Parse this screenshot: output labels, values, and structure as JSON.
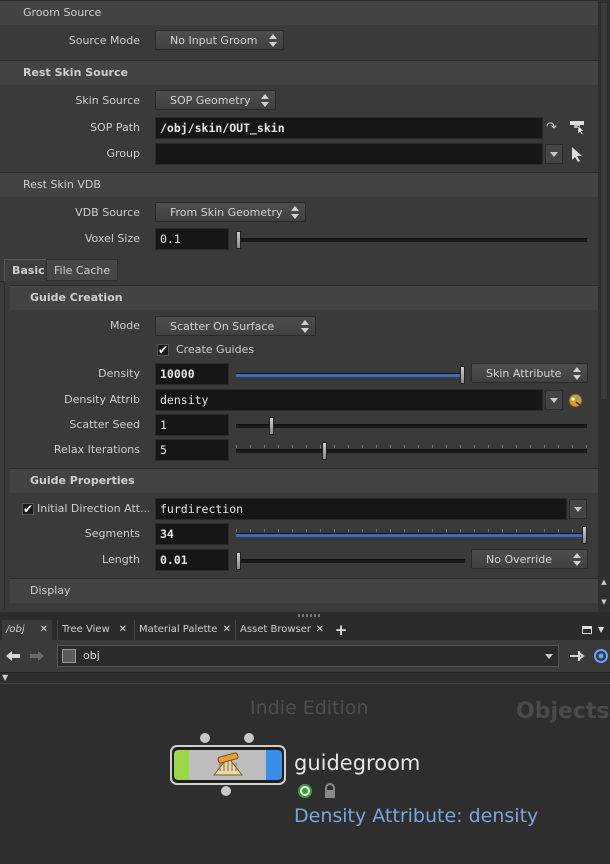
{
  "params": {
    "groom_source": {
      "header": "Groom Source",
      "source_mode_label": "Source Mode",
      "source_mode_value": "No Input Groom"
    },
    "rest_skin_source": {
      "header": "Rest Skin Source",
      "skin_source_label": "Skin Source",
      "skin_source_value": "SOP Geometry",
      "sop_path_label": "SOP Path",
      "sop_path_value": "/obj/skin/OUT_skin",
      "group_label": "Group",
      "group_value": ""
    },
    "rest_skin_vdb": {
      "header": "Rest Skin VDB",
      "vdb_source_label": "VDB Source",
      "vdb_source_value": "From Skin Geometry",
      "voxel_size_label": "Voxel Size",
      "voxel_size_value": "0.1",
      "voxel_size_fraction": 0.0
    },
    "tabs": [
      "Basic",
      "File Cache"
    ],
    "active_tab": "Basic",
    "guide_creation": {
      "header": "Guide Creation",
      "mode_label": "Mode",
      "mode_value": "Scatter On Surface",
      "create_guides_label": "Create Guides",
      "create_guides_checked": true,
      "density_label": "Density",
      "density_value": "10000",
      "density_fraction": 1.0,
      "density_menu_value": "Skin Attribute",
      "density_attrib_label": "Density Attrib",
      "density_attrib_value": "density",
      "scatter_seed_label": "Scatter Seed",
      "scatter_seed_value": "1",
      "scatter_seed_fraction": 0.1,
      "relax_iterations_label": "Relax Iterations",
      "relax_iterations_value": "5",
      "relax_iterations_fraction": 0.25
    },
    "guide_properties": {
      "header": "Guide Properties",
      "initial_direction_label": "Initial Direction Att...",
      "initial_direction_checked": true,
      "initial_direction_value": "furdirection",
      "segments_label": "Segments",
      "segments_value": "34",
      "segments_fraction": 1.0,
      "length_label": "Length",
      "length_value": "0.01",
      "length_fraction": 0.0,
      "length_menu_value": "No Override"
    },
    "display": {
      "header": "Display"
    }
  },
  "pane_tabs": [
    {
      "label": "/obj"
    },
    {
      "label": "Tree View"
    },
    {
      "label": "Material Palette"
    },
    {
      "label": "Asset Browser"
    }
  ],
  "network": {
    "path_value": "obj",
    "watermark_edition": "Indie Edition",
    "watermark_context": "Objects",
    "node_name": "guidegroom",
    "node_comment": "Density Attribute: density"
  },
  "colors": {
    "accent_blue": "#3c6cc0",
    "node_green": "#9ad84a",
    "node_blue": "#3a8ee8",
    "comment_text": "#7aa6e0"
  },
  "icons": {
    "tab_add": "plus-icon",
    "back": "back-arrow-icon",
    "forward": "forward-arrow-icon",
    "pin": "pin-icon",
    "jump": "jump-icon",
    "lock": "lock-icon"
  }
}
